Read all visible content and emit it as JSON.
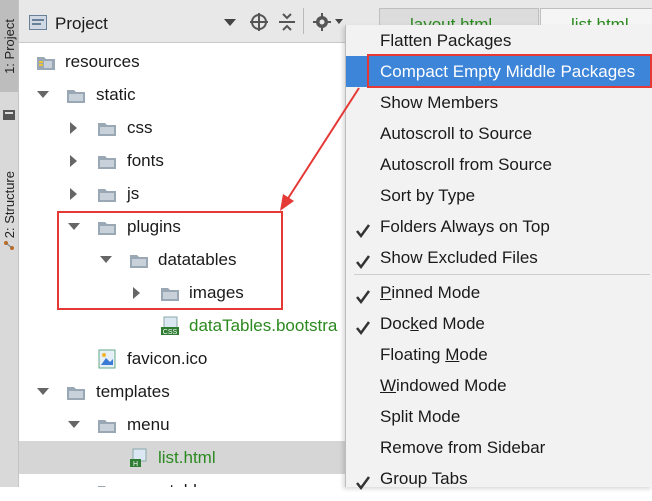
{
  "left_tabs": [
    {
      "label": "1: Project"
    },
    {
      "label": "2: Structure"
    }
  ],
  "toolbar": {
    "title": "Project",
    "icons": [
      "project-view-icon",
      "dropdown-icon",
      "locate-icon",
      "collapse-icon",
      "settings-icon",
      "hide-icon"
    ],
    "tabs": [
      {
        "label": "layout.html"
      },
      {
        "label": "list.html"
      }
    ]
  },
  "tree": [
    {
      "label": "resources",
      "level": 0,
      "arrow": "none",
      "icon": "resource-folder-icon"
    },
    {
      "label": "static",
      "level": 1,
      "arrow": "down",
      "icon": "folder-icon"
    },
    {
      "label": "css",
      "level": 2,
      "arrow": "right",
      "icon": "folder-icon"
    },
    {
      "label": "fonts",
      "level": 2,
      "arrow": "right",
      "icon": "folder-icon"
    },
    {
      "label": "js",
      "level": 2,
      "arrow": "right",
      "icon": "folder-icon"
    },
    {
      "label": "plugins",
      "level": 2,
      "arrow": "down",
      "icon": "folder-icon"
    },
    {
      "label": "datatables",
      "level": 3,
      "arrow": "down",
      "icon": "folder-icon"
    },
    {
      "label": "images",
      "level": 4,
      "arrow": "right",
      "icon": "folder-icon"
    },
    {
      "label": "dataTables.bootstra",
      "level": 4,
      "arrow": "none",
      "icon": "css-file-icon",
      "color": "green"
    },
    {
      "label": "favicon.ico",
      "level": 2,
      "arrow": "none",
      "icon": "image-file-icon"
    },
    {
      "label": "templates",
      "level": 1,
      "arrow": "down",
      "icon": "folder-icon"
    },
    {
      "label": "menu",
      "level": 2,
      "arrow": "down",
      "icon": "folder-icon"
    },
    {
      "label": "list.html",
      "level": 3,
      "arrow": "none",
      "icon": "html-file-icon",
      "color": "green",
      "selected": true
    },
    {
      "label": "user_table",
      "level": 2,
      "arrow": "none",
      "icon": "folder-icon"
    }
  ],
  "menu": {
    "items": [
      {
        "label": "Flatten Packages",
        "checked": false,
        "underline": ""
      },
      {
        "label": "Compact Empty Middle Packages",
        "checked": false,
        "highlighted": true,
        "underline": ""
      },
      {
        "label": "Show Members",
        "checked": false,
        "underline": ""
      },
      {
        "label": "Autoscroll to Source",
        "checked": false,
        "underline": ""
      },
      {
        "label": "Autoscroll from Source",
        "checked": false,
        "underline": ""
      },
      {
        "label": "Sort by Type",
        "checked": false,
        "underline": ""
      },
      {
        "label": "Folders Always on Top",
        "checked": true,
        "underline": ""
      },
      {
        "label": "Show Excluded Files",
        "checked": true,
        "underline": ""
      },
      {
        "label": "Pinned Mode",
        "checked": true,
        "underline": "P",
        "separator_before": true
      },
      {
        "label": "Docked Mode",
        "checked": true,
        "underline": "k"
      },
      {
        "label": "Floating Mode",
        "checked": false,
        "underline": "M"
      },
      {
        "label": "Windowed Mode",
        "checked": false,
        "underline": "W"
      },
      {
        "label": "Split Mode",
        "checked": false,
        "underline": ""
      },
      {
        "label": "Remove from Sidebar",
        "checked": false,
        "underline": ""
      },
      {
        "label": "Group Tabs",
        "checked": true,
        "underline": ""
      }
    ]
  },
  "colors": {
    "highlight": "#3d85d8",
    "annotation": "#e53935",
    "green_text": "#2b8a1f"
  }
}
